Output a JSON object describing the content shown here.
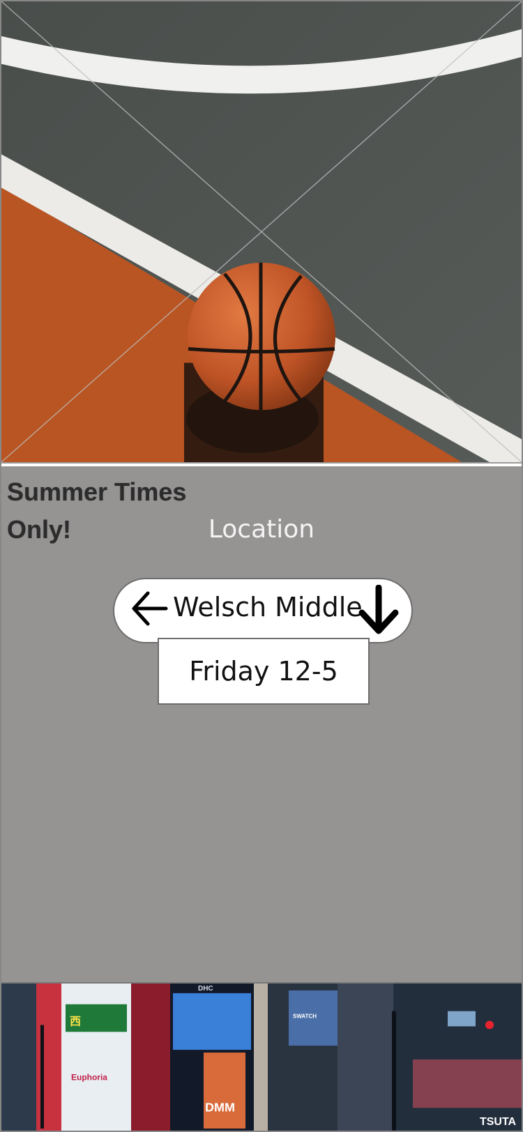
{
  "promo": {
    "headline": "Summer Times Only!"
  },
  "location": {
    "title": "Location",
    "name": "Welsch Middle",
    "back_icon": "arrow-left-icon",
    "expand_icon": "arrow-down-icon"
  },
  "schedule": {
    "time": "Friday 12-5"
  },
  "hero": {
    "image": "basketball-court-photo"
  },
  "city": {
    "image": "city-street-photo",
    "signs": [
      "Euphoria",
      "DMM",
      "DHC",
      "SWATCH",
      "TSUTA"
    ]
  },
  "colors": {
    "panel": "#969393",
    "court_orange": "#b95522",
    "court_gray": "#4f5350",
    "ball": "#c65a2a"
  }
}
